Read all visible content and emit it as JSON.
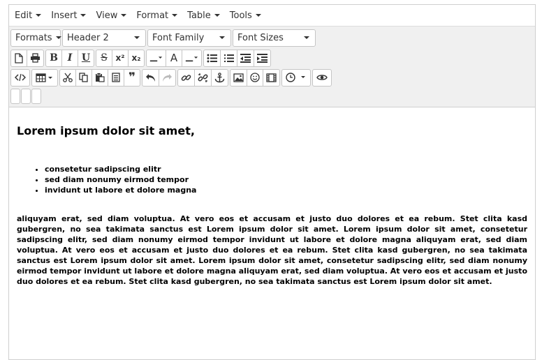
{
  "menubar": {
    "items": [
      "Edit",
      "Insert",
      "View",
      "Format",
      "Table",
      "Tools"
    ]
  },
  "toolbar": {
    "formats_label": "Formats",
    "block_format_value": "Header 2",
    "font_family_label": "Font Family",
    "font_sizes_label": "Font Sizes",
    "bold_label": "B",
    "italic_label": "I",
    "underline_label": "U",
    "strike_label": "S",
    "superscript_label": "x²",
    "subscript_label": "x₂",
    "text_color_label": "A",
    "blockquote_label": "❞"
  },
  "content": {
    "heading": "Lorem ipsum dolor sit amet,",
    "list": [
      "consetetur sadipscing elitr",
      "sed diam nonumy eirmod tempor",
      "invidunt ut labore et dolore magna"
    ],
    "paragraph": "aliquyam erat, sed diam voluptua. At vero eos et accusam et justo duo dolores et ea rebum. Stet clita kasd gubergren, no sea takimata sanctus est Lorem ipsum dolor sit amet. Lorem ipsum dolor sit amet, consetetur sadipscing elitr, sed diam nonumy eirmod tempor invidunt ut labore et dolore magna aliquyam erat, sed diam voluptua. At vero eos et accusam et justo duo dolores et ea rebum. Stet clita kasd gubergren, no sea takimata sanctus est Lorem ipsum dolor sit amet. Lorem ipsum dolor sit amet, consetetur sadipscing elitr, sed diam nonumy eirmod tempor invidunt ut labore et dolore magna aliquyam erat, sed diam voluptua. At vero eos et accusam et justo duo dolores et ea rebum. Stet clita kasd gubergren, no sea takimata sanctus est Lorem ipsum dolor sit amet."
  }
}
